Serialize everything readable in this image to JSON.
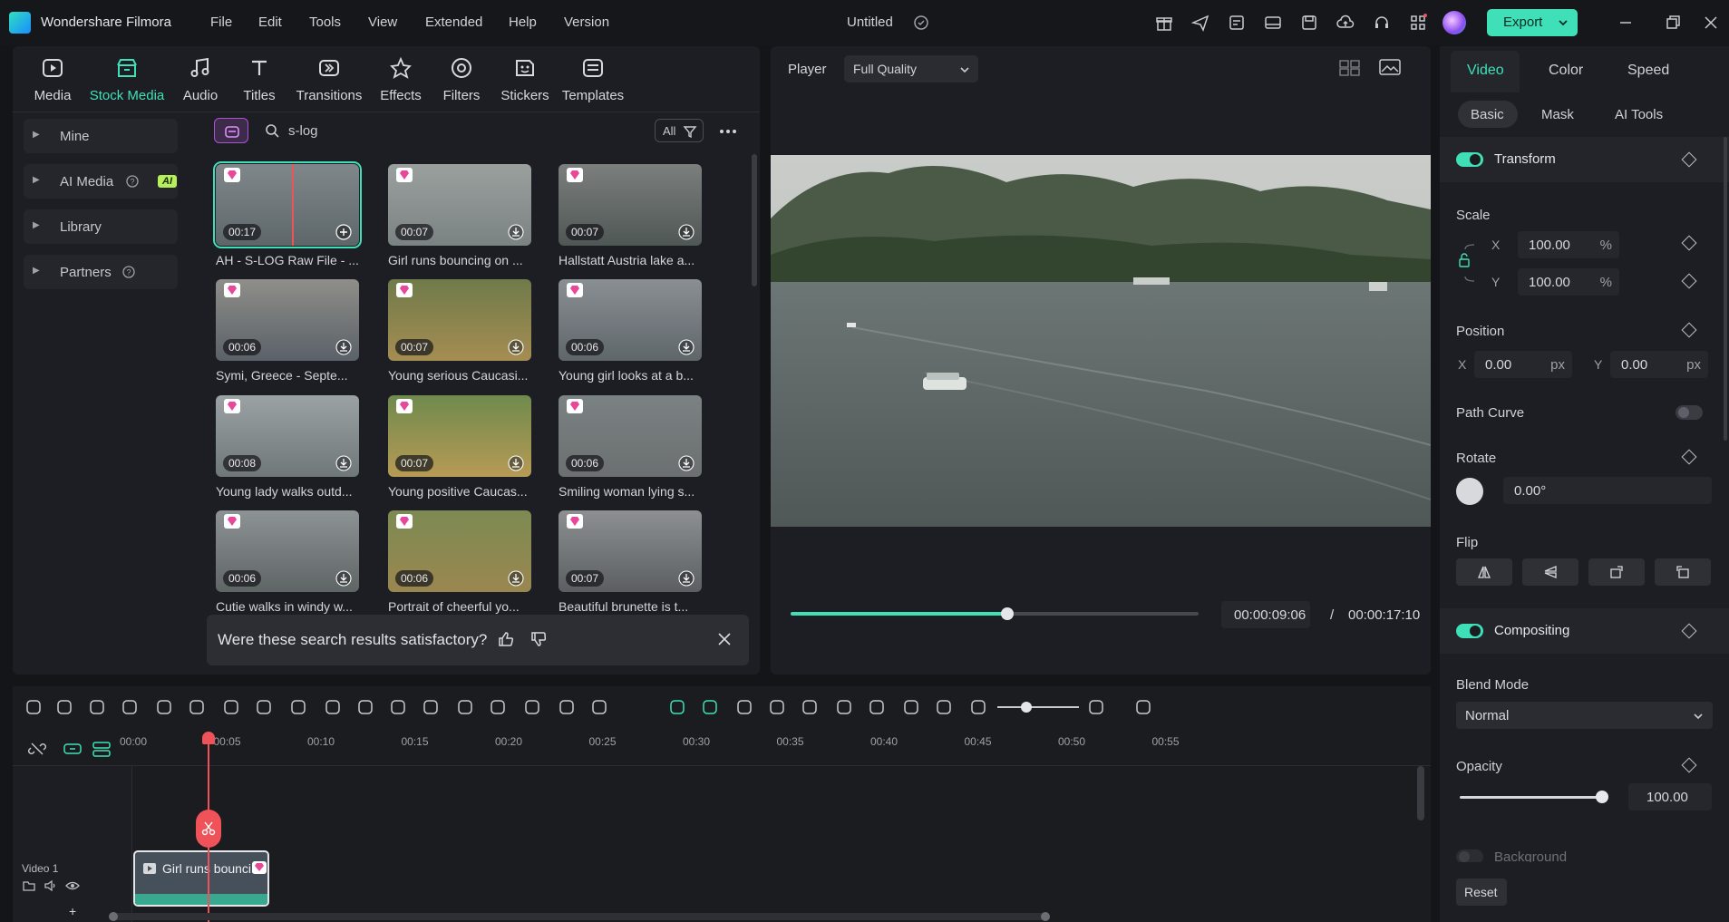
{
  "titlebar": {
    "app_name": "Wondershare Filmora",
    "menus": [
      "File",
      "Edit",
      "Tools",
      "View",
      "Extended",
      "Help",
      "Version"
    ],
    "doc_title": "Untitled",
    "export_label": "Export"
  },
  "media": {
    "categories": [
      "Media",
      "Stock Media",
      "Audio",
      "Titles",
      "Transitions",
      "Effects",
      "Filters",
      "Stickers",
      "Templates"
    ],
    "active_category": "Stock Media",
    "sidebar": [
      "Mine",
      "AI Media",
      "Library",
      "Partners"
    ],
    "ai_badge": "AI",
    "search_value": "s-log",
    "filter_label": "All",
    "items": [
      {
        "duration": "00:17",
        "title": "AH - S-LOG Raw File - ..."
      },
      {
        "duration": "00:07",
        "title": "Girl runs bouncing on ..."
      },
      {
        "duration": "00:07",
        "title": "Hallstatt Austria lake a..."
      },
      {
        "duration": "00:06",
        "title": "Symi, Greece - Septe..."
      },
      {
        "duration": "00:07",
        "title": "Young serious Caucasi..."
      },
      {
        "duration": "00:06",
        "title": "Young girl looks at a b..."
      },
      {
        "duration": "00:08",
        "title": "Young lady walks outd..."
      },
      {
        "duration": "00:07",
        "title": "Young positive Caucas..."
      },
      {
        "duration": "00:06",
        "title": "Smiling woman lying s..."
      },
      {
        "duration": "00:06",
        "title": "Cutie walks in windy w..."
      },
      {
        "duration": "00:06",
        "title": "Portrait of cheerful yo..."
      },
      {
        "duration": "00:07",
        "title": "Beautiful brunette is t..."
      }
    ],
    "feedback_question": "Were these search results satisfactory?"
  },
  "player": {
    "label": "Player",
    "quality": "Full Quality",
    "progress": 0.53,
    "current_time": "00:00:09:06",
    "separator": "/",
    "total_time": "00:00:17:10"
  },
  "props": {
    "tabs": [
      "Video",
      "Color",
      "Speed"
    ],
    "subtabs": [
      "Basic",
      "Mask",
      "AI Tools"
    ],
    "transform": "Transform",
    "scale": "Scale",
    "scale_x_label": "X",
    "scale_x": "100.00",
    "scale_y_label": "Y",
    "scale_y": "100.00",
    "percent": "%",
    "position": "Position",
    "pos_x_label": "X",
    "pos_x": "0.00",
    "pos_y_label": "Y",
    "pos_y": "0.00",
    "px": "px",
    "path_curve": "Path Curve",
    "rotate": "Rotate",
    "rotate_value": "0.00°",
    "flip": "Flip",
    "compositing": "Compositing",
    "blend_mode": "Blend Mode",
    "blend_value": "Normal",
    "opacity": "Opacity",
    "opacity_value": "100.00",
    "background": "Background",
    "reset": "Reset"
  },
  "timeline": {
    "ticks": [
      "00:00",
      "00:05",
      "00:10",
      "00:15",
      "00:20",
      "00:25",
      "00:30",
      "00:35",
      "00:40",
      "00:45",
      "00:50",
      "00:55"
    ],
    "track_label": "Video 1",
    "clip_name": "Girl runs bounci..."
  },
  "colors": {
    "accent": "#3fe0b8",
    "playhead": "#f0525a",
    "premium": "#e8479a"
  }
}
